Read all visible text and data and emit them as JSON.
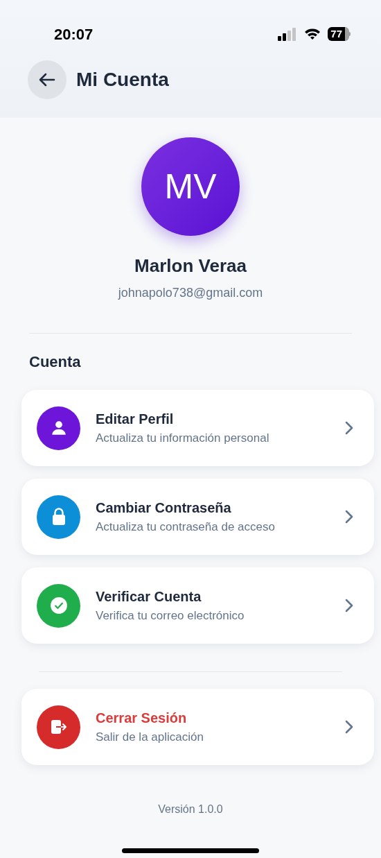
{
  "status_bar": {
    "time": "20:07",
    "battery": "77"
  },
  "header": {
    "title": "Mi Cuenta"
  },
  "profile": {
    "initials": "MV",
    "name": "Marlon Veraa",
    "email": "johnapolo738@gmail.com"
  },
  "section": {
    "title": "Cuenta"
  },
  "items": [
    {
      "kind": "profile",
      "title": "Editar Perfil",
      "subtitle": "Actualiza tu información personal",
      "color": "#6d16d9"
    },
    {
      "kind": "password",
      "title": "Cambiar Contraseña",
      "subtitle": "Actualiza tu contraseña de acceso",
      "color": "#0c8fd6"
    },
    {
      "kind": "verify",
      "title": "Verificar Cuenta",
      "subtitle": "Verifica tu correo electrónico",
      "color": "#1fae4b"
    }
  ],
  "logout": {
    "kind": "logout",
    "title": "Cerrar Sesión",
    "subtitle": "Salir de la aplicación",
    "color": "#d62b2b"
  },
  "version": "Versión 1.0.0"
}
